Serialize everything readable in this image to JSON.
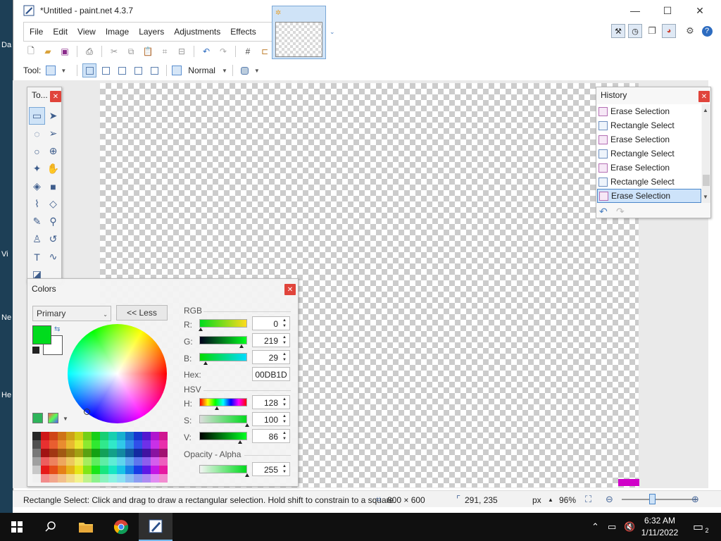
{
  "window": {
    "title": "*Untitled - paint.net 4.3.7",
    "minimize": "—",
    "maximize": "☐",
    "close": "✕"
  },
  "desktop": {
    "labels": [
      "Da",
      "Vi",
      "Ne",
      "He"
    ]
  },
  "menu": [
    "File",
    "Edit",
    "View",
    "Image",
    "Layers",
    "Adjustments",
    "Effects"
  ],
  "toolbar": {
    "tool_label": "Tool:",
    "blend_mode": "Normal"
  },
  "tools_panel": {
    "title": "To...",
    "tools": [
      {
        "icon": "rectangle-select-icon",
        "glyph": "▭",
        "active": true
      },
      {
        "icon": "move-selected-pixels-icon",
        "glyph": "➤",
        "active": false
      },
      {
        "icon": "lasso-select-icon",
        "glyph": "◌",
        "active": false
      },
      {
        "icon": "move-selection-icon",
        "glyph": "➢",
        "active": false
      },
      {
        "icon": "ellipse-select-icon",
        "glyph": "○",
        "active": false
      },
      {
        "icon": "zoom-icon",
        "glyph": "⊕",
        "active": false
      },
      {
        "icon": "magic-wand-icon",
        "glyph": "✦",
        "active": false
      },
      {
        "icon": "pan-icon",
        "glyph": "✋",
        "active": false
      },
      {
        "icon": "paint-bucket-icon",
        "glyph": "◈",
        "active": false
      },
      {
        "icon": "gradient-icon",
        "glyph": "■",
        "active": false
      },
      {
        "icon": "paintbrush-icon",
        "glyph": "⌇",
        "active": false
      },
      {
        "icon": "eraser-icon",
        "glyph": "◇",
        "active": false
      },
      {
        "icon": "pencil-icon",
        "glyph": "✎",
        "active": false
      },
      {
        "icon": "color-picker-icon",
        "glyph": "⚲",
        "active": false
      },
      {
        "icon": "clone-stamp-icon",
        "glyph": "♙",
        "active": false
      },
      {
        "icon": "recolor-icon",
        "glyph": "↺",
        "active": false
      },
      {
        "icon": "text-icon",
        "glyph": "T",
        "active": false
      },
      {
        "icon": "line-curve-icon",
        "glyph": "∿",
        "active": false
      },
      {
        "icon": "shapes-icon",
        "glyph": "◪",
        "active": false
      }
    ]
  },
  "history": {
    "title": "History",
    "items": [
      {
        "label": "Erase Selection",
        "kind": "erase",
        "selected": false
      },
      {
        "label": "Rectangle Select",
        "kind": "select",
        "selected": false
      },
      {
        "label": "Erase Selection",
        "kind": "erase",
        "selected": false
      },
      {
        "label": "Rectangle Select",
        "kind": "select",
        "selected": false
      },
      {
        "label": "Erase Selection",
        "kind": "erase",
        "selected": false
      },
      {
        "label": "Rectangle Select",
        "kind": "select",
        "selected": false
      },
      {
        "label": "Erase Selection",
        "kind": "erase",
        "selected": true
      }
    ]
  },
  "colors": {
    "title": "Colors",
    "target": "Primary",
    "less_button": "<< Less",
    "primary_color": "#00db1d",
    "secondary_color": "#ffffff",
    "rgb_label": "RGB",
    "r_label": "R:",
    "r_value": "0",
    "g_label": "G:",
    "g_value": "219",
    "b_label": "B:",
    "b_value": "29",
    "hex_label": "Hex:",
    "hex_value": "00DB1D",
    "hsv_label": "HSV",
    "h_label": "H:",
    "h_value": "128",
    "s_label": "S:",
    "s_value": "100",
    "v_label": "V:",
    "v_value": "86",
    "alpha_label": "Opacity - Alpha",
    "alpha_value": "255"
  },
  "status": {
    "hint": "Rectangle Select: Click and drag to draw a rectangular selection. Hold shift to constrain to a square.",
    "image_size": "800 × 600",
    "cursor_pos": "291, 235",
    "units": "px",
    "zoom": "96%"
  },
  "taskbar": {
    "time": "6:32 AM",
    "date": "1/11/2022",
    "notification_count": "2"
  }
}
